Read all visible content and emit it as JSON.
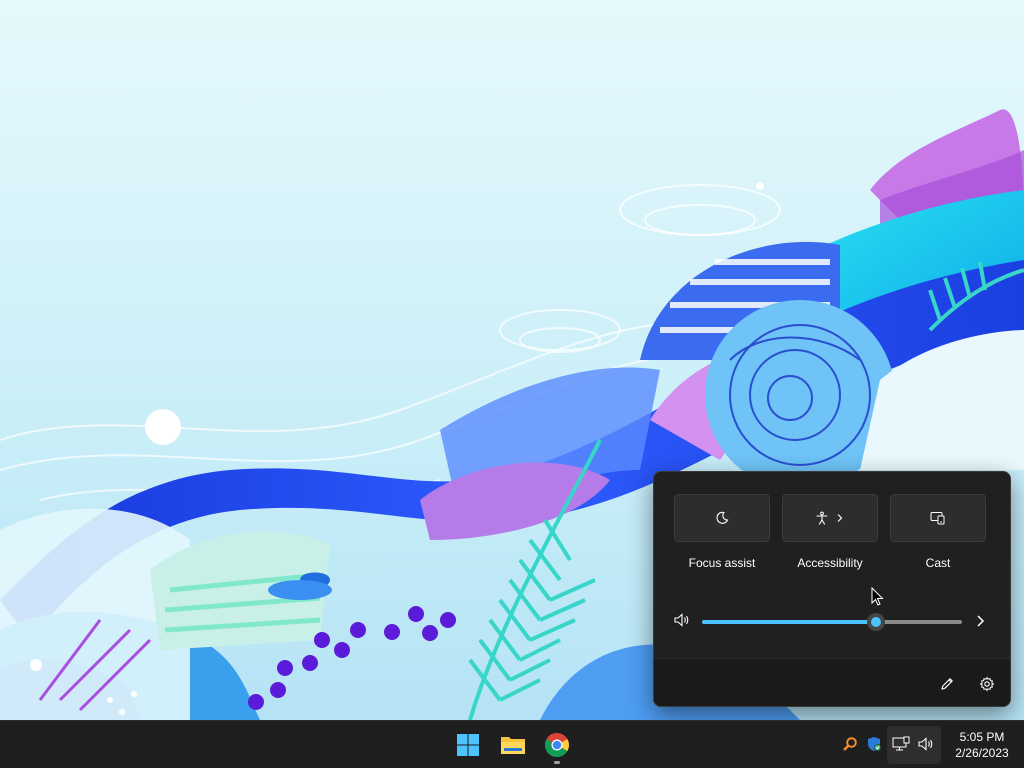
{
  "desktop": {
    "wallpaper": "windows-11-bloom-illustration"
  },
  "quick_settings": {
    "tiles": [
      {
        "label": "Focus assist",
        "icon": "moon-icon"
      },
      {
        "label": "Accessibility",
        "icon": "accessibility-icon",
        "has_chevron": true
      },
      {
        "label": "Cast",
        "icon": "cast-icon"
      }
    ],
    "volume": {
      "level_fraction": 0.67,
      "icon": "speaker-icon"
    },
    "footer": {
      "edit_icon": "pencil-icon",
      "settings_icon": "gear-icon"
    }
  },
  "taskbar": {
    "apps": [
      {
        "name": "Start",
        "icon": "windows-logo-icon"
      },
      {
        "name": "File Explorer",
        "icon": "folder-icon"
      },
      {
        "name": "Google Chrome",
        "icon": "chrome-icon",
        "running": true
      }
    ],
    "tray": {
      "icons": [
        "search-magnifier-icon",
        "security-shield-icon",
        "network-icon",
        "speaker-icon"
      ]
    },
    "clock": {
      "time": "5:05 PM",
      "date": "2/26/2023"
    }
  },
  "colors": {
    "accent": "#4cc2ff",
    "flyout_bg": "#202020",
    "taskbar_bg": "#1f1f1f"
  }
}
